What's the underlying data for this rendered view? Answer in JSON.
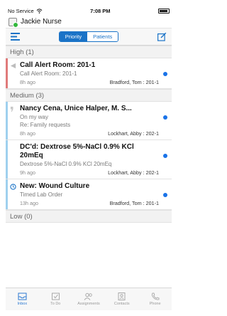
{
  "status": {
    "carrier": "No Service",
    "time": "7:08 PM"
  },
  "user": {
    "name": "Jackie Nurse"
  },
  "navbar": {
    "tabs": [
      {
        "label": "Priority",
        "active": true
      },
      {
        "label": "Patients",
        "active": false
      }
    ]
  },
  "sections": {
    "high": {
      "label": "High",
      "count": "(1)"
    },
    "medium": {
      "label": "Medium",
      "count": "(3)"
    },
    "low": {
      "label": "Low",
      "count": "(0)"
    }
  },
  "messages": [
    {
      "title": "Call Alert Room: 201-1",
      "line1": "Call Alert Room: 201-1",
      "age": "8h ago",
      "who": "Bradford, Tom : 201-1",
      "color": "#e07a7a"
    },
    {
      "title": "Nancy Cena, Unice Halper, M. S...",
      "line1": "On my way",
      "line2": "Re: Family requests",
      "age": "8h ago",
      "who": "Lockhart, Abby : 202-1",
      "color": "#9fd0ee"
    },
    {
      "title": "DC'd: Dextrose 5%-NaCl 0.9% KCl 20mEq",
      "line1": "Dextrose 5%-NaCl 0.9% KCl 20mEq",
      "age": "9h ago",
      "who": "Lockhart, Abby : 202-1",
      "color": "#9fd0ee"
    },
    {
      "title": "New: Wound Culture",
      "line1": "Timed Lab Order",
      "age": "13h ago",
      "who": "Bradford, Tom : 201-1",
      "color": "#9fd0ee"
    }
  ],
  "tabbar": [
    {
      "label": "Inbox",
      "icon": "inbox-icon",
      "active": true
    },
    {
      "label": "To Do",
      "icon": "todo-icon",
      "active": false
    },
    {
      "label": "Assignments",
      "icon": "assignments-icon",
      "active": false
    },
    {
      "label": "Contacts",
      "icon": "contacts-icon",
      "active": false
    },
    {
      "label": "Phone",
      "icon": "phone-icon",
      "active": false
    }
  ],
  "colors": {
    "accent": "#1a73c7",
    "unread_dot": "#1a73e8",
    "presence": "#31b83b"
  }
}
